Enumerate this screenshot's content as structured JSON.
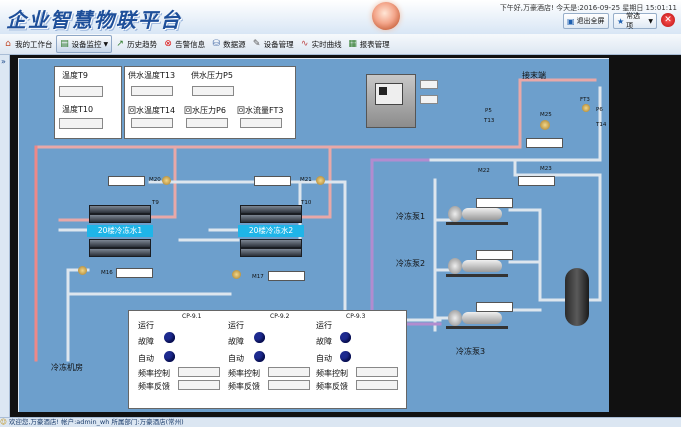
{
  "header": {
    "logo_text": "企业智慧物联平台",
    "welcome": "下午好,万豪酒店! 今天是:2016-09-25 星期日 15:01:11",
    "exit_fullscreen": "退出全屏",
    "quick_options": "常选项"
  },
  "toolbar": {
    "items": [
      "我的工作台",
      "设备监控",
      "历史趋势",
      "告警信息",
      "数据源",
      "设备管理",
      "实时曲线",
      "报表管理"
    ]
  },
  "footer": {
    "text": "欢迎您,万豪酒店! 帐户:admin_wh 所属部门:万豪酒店(常州)"
  },
  "diagram": {
    "labels": {
      "t9": "温度T9",
      "t10": "温度T10",
      "t13": "供水温度T13",
      "p5": "供水压力P5",
      "t14": "回水温度T14",
      "p6": "回水压力P6",
      "f3": "回水流量FT3",
      "terminal": "接末端",
      "room": "冷冻机房",
      "chiller1": "20楼冷冻水1",
      "chiller2": "20楼冷冻水2",
      "pump1": "冷冻泵1",
      "pump2": "冷冻泵2",
      "pump3": "冷冻泵3"
    },
    "tags": {
      "m20": "M20",
      "m21": "M21",
      "m16": "M16",
      "m17": "M17",
      "m22": "M22",
      "m23": "M23",
      "m25": "M25",
      "t9": "T9",
      "t10": "T10",
      "p5": "P5",
      "t13": "T13",
      "ft3": "FT3",
      "p6": "P6",
      "t14": "T14"
    },
    "cp_names": [
      "CP-9.1",
      "CP-9.2",
      "CP-9.3"
    ],
    "cp_rows": [
      "运行",
      "故障",
      "自动",
      "频率控制",
      "频率反馈"
    ]
  }
}
